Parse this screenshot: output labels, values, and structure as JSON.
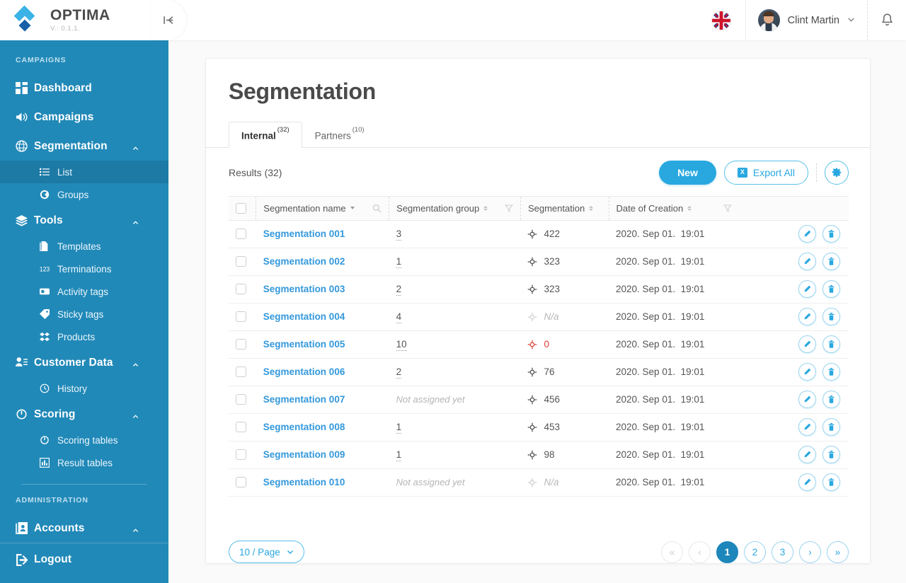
{
  "brand": {
    "name": "OPTIMA",
    "version": "V.: 0.1.1.",
    "collapse_icon": "collapse-left-icon"
  },
  "sidebar": {
    "sections": [
      {
        "title": "CAMPAIGNS"
      },
      {
        "title": "ADMINISTRATION"
      }
    ],
    "campaigns_items": [
      {
        "label": "Dashboard",
        "icon": "dashboard-icon",
        "expandable": false
      },
      {
        "label": "Campaigns",
        "icon": "megaphone-icon",
        "expandable": false
      },
      {
        "label": "Segmentation",
        "icon": "globe-grid-icon",
        "expandable": true,
        "expanded": true
      },
      {
        "label": "Tools",
        "icon": "layers-icon",
        "expandable": true,
        "expanded": true
      },
      {
        "label": "Customer Data",
        "icon": "user-list-icon",
        "expandable": true,
        "expanded": true
      },
      {
        "label": "Scoring",
        "icon": "gauge-icon",
        "expandable": true,
        "expanded": true
      }
    ],
    "segmentation_subitems": [
      {
        "label": "List",
        "icon": "list-icon",
        "active": true
      },
      {
        "label": "Groups",
        "icon": "circle-icon",
        "active": false
      }
    ],
    "tools_subitems": [
      {
        "label": "Templates",
        "icon": "document-icon"
      },
      {
        "label": "Terminations",
        "icon": "numbers-icon"
      },
      {
        "label": "Activity tags",
        "icon": "activity-tag-icon"
      },
      {
        "label": "Sticky tags",
        "icon": "tag-icon"
      },
      {
        "label": "Products",
        "icon": "products-icon"
      }
    ],
    "customer_data_subitems": [
      {
        "label": "History",
        "icon": "clock-history-icon"
      }
    ],
    "scoring_subitems": [
      {
        "label": "Scoring tables",
        "icon": "gauge-icon"
      },
      {
        "label": "Result tables",
        "icon": "bar-chart-icon"
      }
    ],
    "admin_items": [
      {
        "label": "Accounts",
        "icon": "accounts-icon",
        "expandable": true,
        "expanded": true
      }
    ],
    "logout": {
      "label": "Logout",
      "icon": "logout-icon"
    }
  },
  "topbar": {
    "language_flag": "uk-flag-icon",
    "user_name": "Clint Martin",
    "user_caret": "chevron-down-icon",
    "notifications_icon": "bell-icon",
    "avatar": "avatar"
  },
  "page": {
    "title": "Segmentation",
    "tabs": [
      {
        "label": "Internal",
        "count": "(32)",
        "active": true
      },
      {
        "label": "Partners",
        "count": "(10)",
        "active": false
      }
    ]
  },
  "toolbar": {
    "results_label": "Results (32)",
    "new_label": "New",
    "export_label": "Export All",
    "export_icon_text": "X",
    "settings_icon": "gear-icon"
  },
  "table": {
    "columns": [
      {
        "label": "Segmentation name",
        "sort": "desc",
        "tool": "search-icon"
      },
      {
        "label": "Segmentation group",
        "sort": "both",
        "tool": "filter-icon"
      },
      {
        "label": "Segmentation",
        "sort": "both",
        "tool": ""
      },
      {
        "label": "Date of Creation",
        "sort": "both",
        "tool": "filter-icon"
      }
    ],
    "rows": [
      {
        "name": "Segmentation 001",
        "group": "3",
        "group_assigned": true,
        "segmentation": "422",
        "seg_state": "normal",
        "date": "2020. Sep 01.",
        "time": "19:01"
      },
      {
        "name": "Segmentation 002",
        "group": "1",
        "group_assigned": true,
        "segmentation": "323",
        "seg_state": "normal",
        "date": "2020. Sep 01.",
        "time": "19:01"
      },
      {
        "name": "Segmentation 003",
        "group": "2",
        "group_assigned": true,
        "segmentation": "323",
        "seg_state": "normal",
        "date": "2020. Sep 01.",
        "time": "19:01"
      },
      {
        "name": "Segmentation 004",
        "group": "4",
        "group_assigned": true,
        "segmentation": "N/a",
        "seg_state": "na",
        "date": "2020. Sep 01.",
        "time": "19:01"
      },
      {
        "name": "Segmentation 005",
        "group": "10",
        "group_assigned": true,
        "segmentation": "0",
        "seg_state": "zero",
        "date": "2020. Sep 01.",
        "time": "19:01"
      },
      {
        "name": "Segmentation 006",
        "group": "2",
        "group_assigned": true,
        "segmentation": "76",
        "seg_state": "normal",
        "date": "2020. Sep 01.",
        "time": "19:01"
      },
      {
        "name": "Segmentation 007",
        "group": "Not assigned yet",
        "group_assigned": false,
        "segmentation": "456",
        "seg_state": "normal",
        "date": "2020. Sep 01.",
        "time": "19:01"
      },
      {
        "name": "Segmentation 008",
        "group": "1",
        "group_assigned": true,
        "segmentation": "453",
        "seg_state": "normal",
        "date": "2020. Sep 01.",
        "time": "19:01"
      },
      {
        "name": "Segmentation 009",
        "group": "1",
        "group_assigned": true,
        "segmentation": "98",
        "seg_state": "normal",
        "date": "2020. Sep 01.",
        "time": "19:01"
      },
      {
        "name": "Segmentation 010",
        "group": "Not assigned yet",
        "group_assigned": false,
        "segmentation": "N/a",
        "seg_state": "na",
        "date": "2020. Sep 01.",
        "time": "19:01"
      }
    ],
    "row_actions": {
      "edit_icon": "pencil-icon",
      "delete_icon": "trash-icon"
    }
  },
  "footer": {
    "per_page_label": "10 / Page",
    "pagination": [
      {
        "label": "«",
        "name": "first-page",
        "state": "disabled"
      },
      {
        "label": "‹",
        "name": "prev-page",
        "state": "disabled"
      },
      {
        "label": "1",
        "name": "page-1",
        "state": "active"
      },
      {
        "label": "2",
        "name": "page-2",
        "state": "normal"
      },
      {
        "label": "3",
        "name": "page-3",
        "state": "normal"
      },
      {
        "label": "›",
        "name": "next-page",
        "state": "normal"
      },
      {
        "label": "»",
        "name": "last-page",
        "state": "normal"
      }
    ]
  },
  "colors": {
    "sidebar": "#2189b8",
    "sidebar_active": "#1d7aa5",
    "accent": "#29a8e0",
    "link": "#3398db",
    "danger": "#e03b2f",
    "page_bg": "#fafafa"
  }
}
